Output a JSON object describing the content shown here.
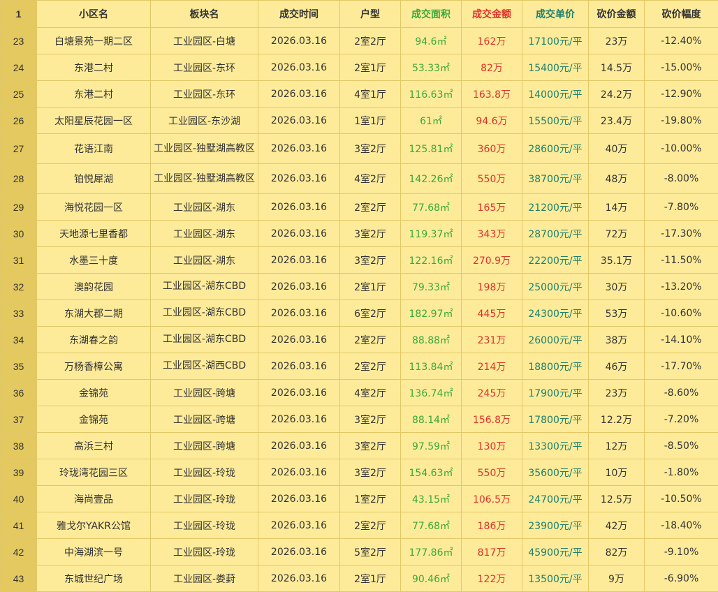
{
  "colors": {
    "area": "#3aa83a",
    "amount": "#e0302a",
    "unit_price": "#1d7f6e",
    "background": "#fdeb9a",
    "row_header": "#e3c95f"
  },
  "header": {
    "row_number": "1",
    "columns": [
      "小区名",
      "板块名",
      "成交时间",
      "户型",
      "成交面积",
      "成交金额",
      "成交单价",
      "砍价金额",
      "砍价幅度"
    ]
  },
  "rows": [
    {
      "n": "23",
      "name": "白塘景苑一期二区",
      "block": "工业园区-白塘",
      "date": "2026.03.16",
      "layout": "2室2厅",
      "area": "94.6㎡",
      "amount": "162万",
      "unit": "17100元/平",
      "cut": "23万",
      "pct": "-12.40%"
    },
    {
      "n": "24",
      "name": "东港二村",
      "block": "工业园区-东环",
      "date": "2026.03.16",
      "layout": "2室1厅",
      "area": "53.33㎡",
      "amount": "82万",
      "unit": "15400元/平",
      "cut": "14.5万",
      "pct": "-15.00%"
    },
    {
      "n": "25",
      "name": "东港二村",
      "block": "工业园区-东环",
      "date": "2026.03.16",
      "layout": "4室1厅",
      "area": "116.63㎡",
      "amount": "163.8万",
      "unit": "14000元/平",
      "cut": "24.2万",
      "pct": "-12.90%"
    },
    {
      "n": "26",
      "name": "太阳星辰花园一区",
      "block": "工业园区-东沙湖",
      "date": "2026.03.16",
      "layout": "1室1厅",
      "area": "61㎡",
      "amount": "94.6万",
      "unit": "15500元/平",
      "cut": "23.4万",
      "pct": "-19.80%"
    },
    {
      "n": "27",
      "name": "花语江南",
      "block": "工业园区-独墅湖高教区",
      "date": "2026.03.16",
      "layout": "3室2厅",
      "area": "125.81㎡",
      "amount": "360万",
      "unit": "28600元/平",
      "cut": "40万",
      "pct": "-10.00%"
    },
    {
      "n": "28",
      "name": "铂悦犀湖",
      "block": "工业园区-独墅湖高教区",
      "date": "2026.03.16",
      "layout": "4室2厅",
      "area": "142.26㎡",
      "amount": "550万",
      "unit": "38700元/平",
      "cut": "48万",
      "pct": "-8.00%"
    },
    {
      "n": "29",
      "name": "海悦花园一区",
      "block": "工业园区-湖东",
      "date": "2026.03.16",
      "layout": "2室2厅",
      "area": "77.68㎡",
      "amount": "165万",
      "unit": "21200元/平",
      "cut": "14万",
      "pct": "-7.80%"
    },
    {
      "n": "30",
      "name": "天地源七里香都",
      "block": "工业园区-湖东",
      "date": "2026.03.16",
      "layout": "3室2厅",
      "area": "119.37㎡",
      "amount": "343万",
      "unit": "28700元/平",
      "cut": "72万",
      "pct": "-17.30%"
    },
    {
      "n": "31",
      "name": "水墨三十度",
      "block": "工业园区-湖东",
      "date": "2026.03.16",
      "layout": "3室2厅",
      "area": "122.16㎡",
      "amount": "270.9万",
      "unit": "22200元/平",
      "cut": "35.1万",
      "pct": "-11.50%"
    },
    {
      "n": "32",
      "name": "澳韵花园",
      "block": "工业园区-湖东CBD",
      "date": "2026.03.16",
      "layout": "2室1厅",
      "area": "79.33㎡",
      "amount": "198万",
      "unit": "25000元/平",
      "cut": "30万",
      "pct": "-13.20%"
    },
    {
      "n": "33",
      "name": "东湖大郡二期",
      "block": "工业园区-湖东CBD",
      "date": "2026.03.16",
      "layout": "6室2厅",
      "area": "182.97㎡",
      "amount": "445万",
      "unit": "24300元/平",
      "cut": "53万",
      "pct": "-10.60%"
    },
    {
      "n": "34",
      "name": "东湖春之韵",
      "block": "工业园区-湖东CBD",
      "date": "2026.03.16",
      "layout": "2室2厅",
      "area": "88.88㎡",
      "amount": "231万",
      "unit": "26000元/平",
      "cut": "38万",
      "pct": "-14.10%"
    },
    {
      "n": "35",
      "name": "万杨香樟公寓",
      "block": "工业园区-湖西CBD",
      "date": "2026.03.16",
      "layout": "2室2厅",
      "area": "113.84㎡",
      "amount": "214万",
      "unit": "18800元/平",
      "cut": "46万",
      "pct": "-17.70%"
    },
    {
      "n": "36",
      "name": "金锦苑",
      "block": "工业园区-跨塘",
      "date": "2026.03.16",
      "layout": "4室2厅",
      "area": "136.74㎡",
      "amount": "245万",
      "unit": "17900元/平",
      "cut": "23万",
      "pct": "-8.60%"
    },
    {
      "n": "37",
      "name": "金锦苑",
      "block": "工业园区-跨塘",
      "date": "2026.03.16",
      "layout": "3室2厅",
      "area": "88.14㎡",
      "amount": "156.8万",
      "unit": "17800元/平",
      "cut": "12.2万",
      "pct": "-7.20%"
    },
    {
      "n": "38",
      "name": "高浜三村",
      "block": "工业园区-跨塘",
      "date": "2026.03.16",
      "layout": "3室2厅",
      "area": "97.59㎡",
      "amount": "130万",
      "unit": "13300元/平",
      "cut": "12万",
      "pct": "-8.50%"
    },
    {
      "n": "39",
      "name": "玲珑湾花园三区",
      "block": "工业园区-玲珑",
      "date": "2026.03.16",
      "layout": "3室2厅",
      "area": "154.63㎡",
      "amount": "550万",
      "unit": "35600元/平",
      "cut": "10万",
      "pct": "-1.80%"
    },
    {
      "n": "40",
      "name": "海尚壹品",
      "block": "工业园区-玲珑",
      "date": "2026.03.16",
      "layout": "1室2厅",
      "area": "43.15㎡",
      "amount": "106.5万",
      "unit": "24700元/平",
      "cut": "12.5万",
      "pct": "-10.50%"
    },
    {
      "n": "41",
      "name": "雅戈尔YAKR公馆",
      "block": "工业园区-玲珑",
      "date": "2026.03.16",
      "layout": "2室2厅",
      "area": "77.68㎡",
      "amount": "186万",
      "unit": "23900元/平",
      "cut": "42万",
      "pct": "-18.40%"
    },
    {
      "n": "42",
      "name": "中海湖滨一号",
      "block": "工业园区-玲珑",
      "date": "2026.03.16",
      "layout": "5室2厅",
      "area": "177.86㎡",
      "amount": "817万",
      "unit": "45900元/平",
      "cut": "82万",
      "pct": "-9.10%"
    },
    {
      "n": "43",
      "name": "东城世纪广场",
      "block": "工业园区-娄葑",
      "date": "2026.03.16",
      "layout": "2室1厅",
      "area": "90.46㎡",
      "amount": "122万",
      "unit": "13500元/平",
      "cut": "9万",
      "pct": "-6.90%"
    }
  ]
}
